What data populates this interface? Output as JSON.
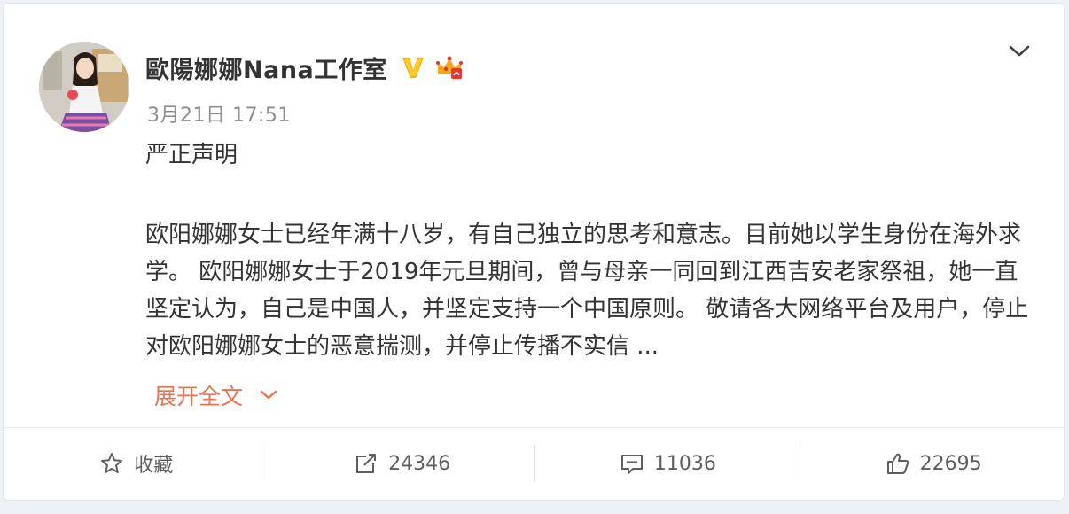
{
  "post": {
    "author_name": "歐陽娜娜Nana工作室",
    "verified_icon": "verified-v-icon",
    "member_icon": "crown-vip-icon",
    "timestamp": "3月21日 17:51",
    "title": "严正声明",
    "body": "欧阳娜娜女士已经年满十八岁，有自己独立的思考和意志。目前她以学生身份在海外求学。 欧阳娜娜女士于2019年元旦期间，曾与母亲一同回到江西吉安老家祭祖，她一直坚定认为，自己是中国人，并坚定支持一个中国原则。 敬请各大网络平台及用户，停止对欧阳娜娜女士的恶意揣测，并停止传播不实信 ...",
    "expand_label": "展开全文"
  },
  "actions": {
    "favorite": {
      "label": "收藏",
      "icon": "star-icon"
    },
    "repost": {
      "label": "24346",
      "icon": "repost-icon"
    },
    "comment": {
      "label": "11036",
      "icon": "comment-icon"
    },
    "like": {
      "label": "22695",
      "icon": "thumbs-up-icon"
    }
  },
  "colors": {
    "link": "#eb7350",
    "verified": "#f7b500",
    "muted": "#8e8e8e",
    "text": "#333333"
  }
}
